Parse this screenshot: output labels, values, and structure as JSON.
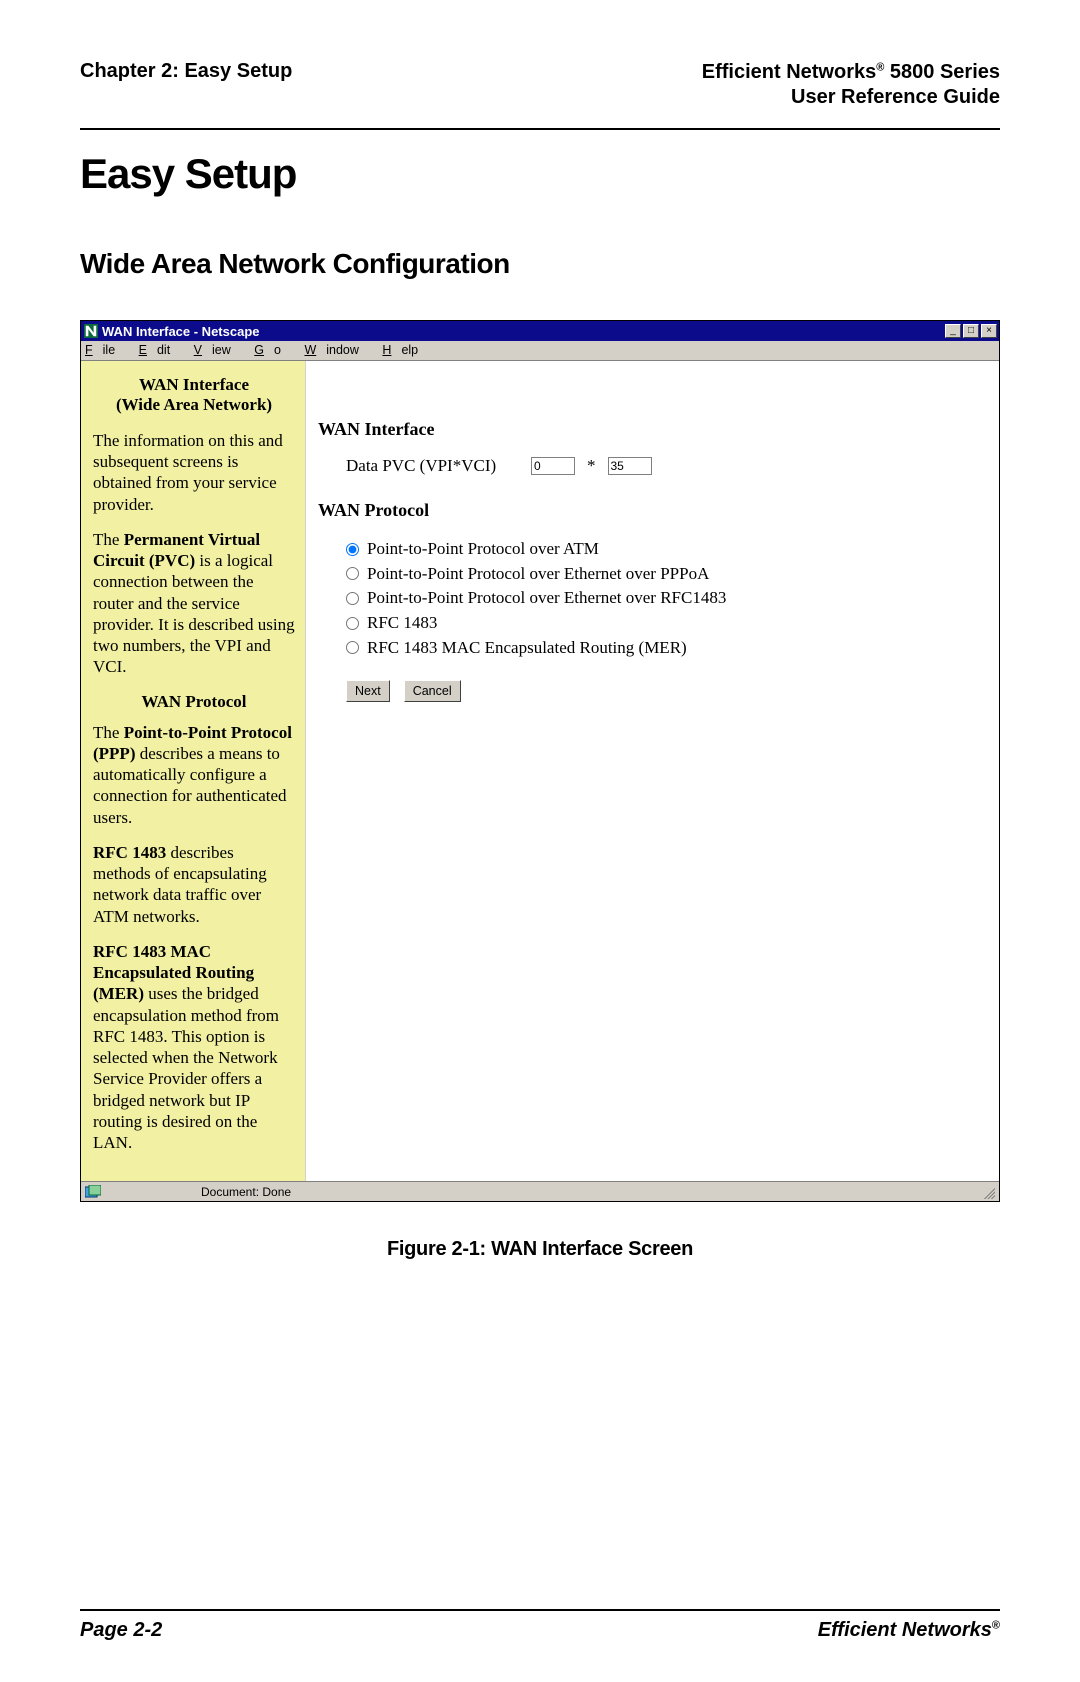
{
  "header": {
    "chapter": "Chapter 2: Easy Setup",
    "brand_line1_pre": "Efficient Networks",
    "brand_line1_sup": "®",
    "brand_line1_post": " 5800 Series",
    "brand_line2": "User Reference Guide"
  },
  "h1": "Easy Setup",
  "h2": "Wide Area Network Configuration",
  "netscape": {
    "title": "WAN Interface - Netscape",
    "menus": {
      "file_u": "F",
      "file_r": "ile",
      "edit_u": "E",
      "edit_r": "dit",
      "view_u": "V",
      "view_r": "iew",
      "go_u": "G",
      "go_r": "o",
      "window_u": "W",
      "window_r": "indow",
      "help_u": "H",
      "help_r": "elp"
    },
    "status": "Document: Done"
  },
  "side": {
    "h1": "WAN Interface",
    "h2": "(Wide Area Network)",
    "p1": "The information on this and subsequent screens is obtained from your service provider.",
    "p2_pre": "The ",
    "p2_b": "Permanent Virtual Circuit (PVC)",
    "p2_post": " is a logical connection between the router and the service provider. It is described using two numbers, the VPI and VCI.",
    "sub": "WAN Protocol",
    "p3_pre": "The ",
    "p3_b": "Point-to-Point Protocol (PPP)",
    "p3_post": " describes a means to automatically configure a connection for authenticated users.",
    "p4_b": "RFC 1483",
    "p4_post": " describes methods of encapsulating network data traffic over ATM networks.",
    "p5_b": "RFC 1483 MAC Encapsulated Routing (MER)",
    "p5_post": " uses the bridged encapsulation method from RFC 1483. This option is selected when the Network Service Provider offers a bridged network but IP routing is desired on the LAN."
  },
  "main": {
    "wan_h": "WAN Interface",
    "pvc_label": "Data PVC (VPI*VCI)",
    "vpi_value": "0",
    "star": "*",
    "vci_value": "35",
    "proto_h": "WAN Protocol",
    "radios": [
      "Point-to-Point Protocol over ATM",
      "Point-to-Point Protocol over Ethernet over PPPoA",
      "Point-to-Point Protocol over Ethernet over RFC1483",
      "RFC 1483",
      "RFC 1483 MAC Encapsulated Routing (MER)"
    ],
    "next": "Next",
    "cancel": "Cancel"
  },
  "figure_caption": "Figure 2-1:  WAN Interface Screen",
  "footer": {
    "page": "Page 2-2",
    "brand": "Efficient Networks",
    "brand_sup": "®"
  }
}
